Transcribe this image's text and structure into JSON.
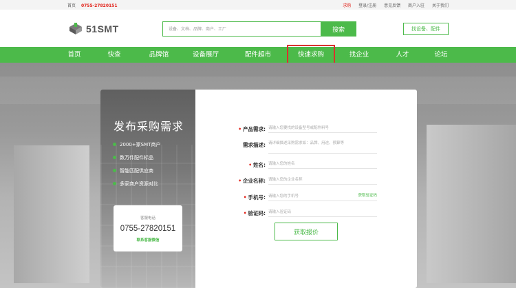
{
  "topbar": {
    "home": "首页",
    "phone": "0755-27820151",
    "links": [
      "求购",
      "登录/注册",
      "意见反馈",
      "商户入驻",
      "关于我们"
    ]
  },
  "header": {
    "logo_text": "51SMT",
    "search_placeholder": "设备、文档、品牌、商户、工厂",
    "search_button": "搜索",
    "find_button": "找设备、配件"
  },
  "nav": {
    "items": [
      "首页",
      "快查",
      "品牌馆",
      "设备展厅",
      "配件超市",
      "快速求购",
      "找企业",
      "人才",
      "论坛"
    ],
    "highlighted": "快速求购"
  },
  "card": {
    "title": "发布采购需求",
    "features": [
      "2000+家SMT商户",
      "数万件配件标品",
      "智能匹配供应商",
      "多家商户资源对比"
    ],
    "service": {
      "label": "客服电话",
      "phone": "0755-27820151",
      "wechat": "联系客服微信"
    }
  },
  "form": {
    "product_label": "产品需求:",
    "product_placeholder": "请输入您要找的设备型号或配件料号",
    "desc_label": "需求描述:",
    "desc_placeholder": "请详细描述采购需求如：品牌、用途、预算等",
    "name_label": "姓名:",
    "name_placeholder": "请输入您的姓名",
    "company_label": "企业名称:",
    "company_placeholder": "请输入您的企业名称",
    "phone_label": "手机号:",
    "phone_placeholder": "请输入您的手机号",
    "get_code": "获取验证码",
    "code_label": "验证码:",
    "code_placeholder": "请输入验证码",
    "submit": "获取报价"
  },
  "colors": {
    "accent": "#4cba4a",
    "alert": "#e2231a"
  }
}
